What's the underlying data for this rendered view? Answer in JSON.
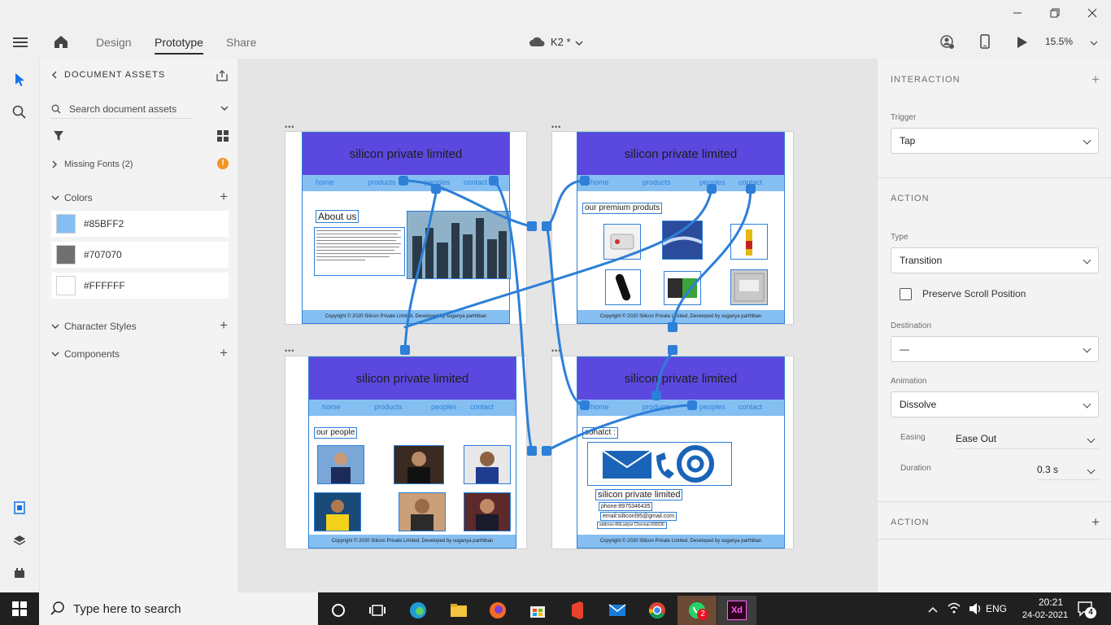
{
  "toolbar": {
    "tabs": {
      "design": "Design",
      "prototype": "Prototype",
      "share": "Share"
    },
    "document_title": "K2 *",
    "zoom": "15.5%"
  },
  "assets": {
    "header": "DOCUMENT ASSETS",
    "search_placeholder": "Search document assets",
    "missing_fonts": "Missing Fonts (2)",
    "colors_label": "Colors",
    "colors": [
      {
        "hex": "#85BFF2"
      },
      {
        "hex": "#707070"
      },
      {
        "hex": "#FFFFFF"
      }
    ],
    "character_styles_label": "Character Styles",
    "components_label": "Components"
  },
  "artboards": {
    "site_title": "silicon private limited",
    "nav": [
      "home",
      "products",
      "peoples",
      "contact"
    ],
    "about_heading": "About us",
    "footer_a": "Copyright © 2020 Silicon Private Limited, Developed by suganya parthiban",
    "products_heading": "our premium produts",
    "people_heading": "our people",
    "contact_heading": "conatct :",
    "contact_company": "silicon private limited",
    "contact_phone": "phone:8975346435",
    "contact_email": "email:silliconl95@gmail.com",
    "contact_address": "address:46b,adyar Chennai-600036"
  },
  "props": {
    "interaction_title": "INTERACTION",
    "trigger_label": "Trigger",
    "trigger_value": "Tap",
    "action_title": "ACTION",
    "type_label": "Type",
    "type_value": "Transition",
    "preserve_label": "Preserve Scroll Position",
    "destination_label": "Destination",
    "destination_value": "—",
    "animation_label": "Animation",
    "animation_value": "Dissolve",
    "easing_label": "Easing",
    "easing_value": "Ease Out",
    "duration_label": "Duration",
    "duration_value": "0.3 s",
    "action2_title": "ACTION"
  },
  "taskbar": {
    "search_placeholder": "Type here to search",
    "language": "ENG",
    "time": "20:21",
    "date": "24-02-2021",
    "notification_count": "4",
    "whatsapp_badge": "2",
    "xd_label": "Xd"
  },
  "colors": {
    "accent": "#5b48de",
    "link_blue": "#2d7fd8",
    "nav_blue": "#85bff2"
  }
}
